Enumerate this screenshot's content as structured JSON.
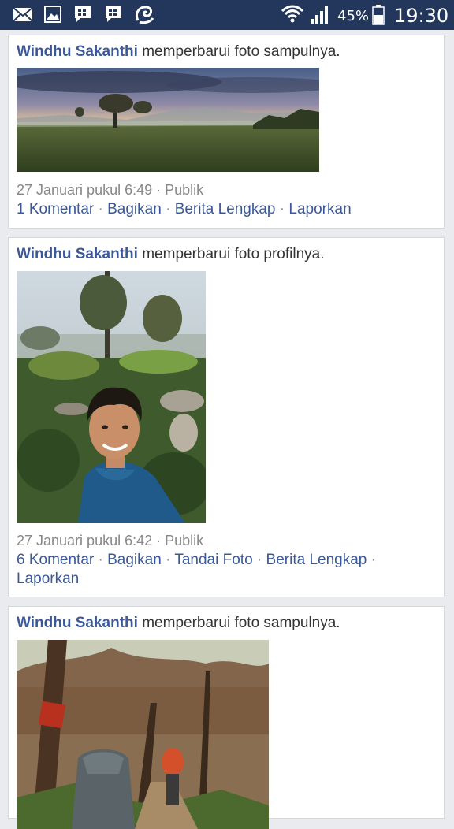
{
  "status_bar": {
    "battery": "45%",
    "time": "19:30",
    "icons": [
      "mail-icon",
      "gallery-icon",
      "bbm-icon",
      "bbm-icon",
      "uc-browser-icon",
      "wifi-icon",
      "signal-icon",
      "battery-icon"
    ]
  },
  "posts": [
    {
      "author": "Windhu Sakanthi",
      "action_text": " memperbarui foto sampulnya.",
      "date": "27 Januari pukul 6:49",
      "separator": " · ",
      "privacy": "Publik",
      "actions": [
        "1 Komentar",
        "Bagikan",
        "Berita Lengkap",
        "Laporkan"
      ]
    },
    {
      "author": "Windhu Sakanthi",
      "action_text": " memperbarui foto profilnya.",
      "date": "27 Januari pukul 6:42",
      "separator": " · ",
      "privacy": "Publik",
      "actions": [
        "6 Komentar",
        "Bagikan",
        "Tandai Foto",
        "Berita Lengkap",
        "Laporkan"
      ]
    },
    {
      "author": "Windhu Sakanthi",
      "action_text": " memperbarui foto sampulnya."
    }
  ],
  "colors": {
    "status_bar": "#23375c",
    "link": "#3b5998",
    "page_bg": "#e9ebee"
  }
}
